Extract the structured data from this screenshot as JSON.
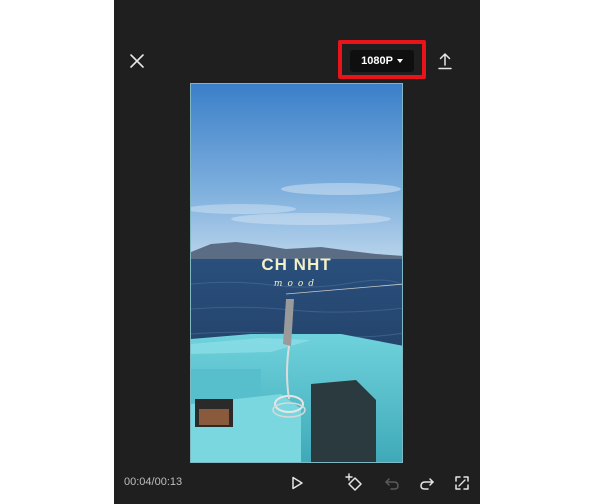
{
  "app": {
    "resolution_label": "1080P",
    "resolution_highlight_color": "#e8141a"
  },
  "preview": {
    "caption_title": "CH NHT",
    "caption_subtitle": "mood"
  },
  "playback": {
    "timecode": "00:04/00:13"
  },
  "icons": {
    "close": "close-icon",
    "resolution_dropdown": "chevron-down-icon",
    "export": "upload-icon",
    "play": "play-icon",
    "keyframe": "keyframe-add-icon",
    "undo": "undo-icon",
    "redo": "redo-icon",
    "fullscreen": "fullscreen-icon"
  }
}
